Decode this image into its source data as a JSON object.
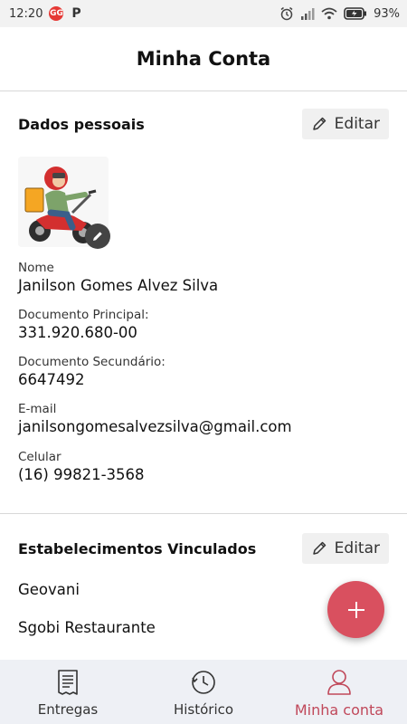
{
  "status_bar": {
    "time": "12:20",
    "badge": "GG",
    "app_letter": "P",
    "battery": "93%"
  },
  "header": {
    "title": "Minha Conta"
  },
  "personal": {
    "title": "Dados pessoais",
    "edit_label": "Editar",
    "fields": [
      {
        "label": "Nome",
        "value": "Janilson Gomes Alvez Silva"
      },
      {
        "label": "Documento Principal:",
        "value": "331.920.680-00"
      },
      {
        "label": "Documento Secundário:",
        "value": "6647492"
      },
      {
        "label": "E-mail",
        "value": "janilsongomesalvezsilva@gmail.com"
      },
      {
        "label": "Celular",
        "value": "(16) 99821-3568"
      }
    ]
  },
  "establishments": {
    "title": "Estabelecimentos Vinculados",
    "edit_label": "Editar",
    "items": [
      "Geovani",
      "Sgobi Restaurante"
    ]
  },
  "fab": {
    "icon": "plus-icon"
  },
  "bottom_nav": {
    "items": [
      {
        "label": "Entregas",
        "icon": "document-list-icon",
        "active": false
      },
      {
        "label": "Histórico",
        "icon": "history-clock-icon",
        "active": false
      },
      {
        "label": "Minha conta",
        "icon": "user-icon",
        "active": true
      }
    ]
  },
  "colors": {
    "accent": "#d9505f",
    "active_nav": "#c0485a",
    "nav_bg": "#eef0f5",
    "edit_bg": "#f0f0f0"
  }
}
